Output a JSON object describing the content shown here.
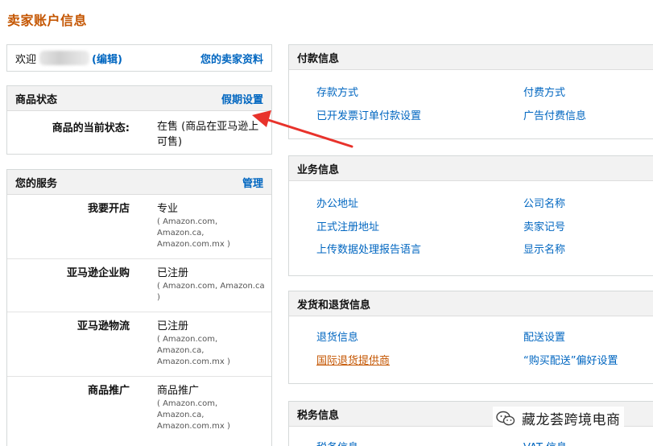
{
  "page": {
    "title": "卖家账户信息"
  },
  "welcome": {
    "label": "欢迎",
    "edit": "(编辑)",
    "profile_link": "您的卖家资料"
  },
  "status": {
    "title": "商品状态",
    "action": "假期设置",
    "row_key": "商品的当前状态:",
    "row_value": "在售 (商品在亚马逊上可售)"
  },
  "services": {
    "title": "您的服务",
    "action": "管理",
    "rows": [
      {
        "key": "我要开店",
        "value": "专业",
        "sub": "( Amazon.com, Amazon.ca, Amazon.com.mx )"
      },
      {
        "key": "亚马逊企业购",
        "value": "已注册",
        "sub": "( Amazon.com, Amazon.ca )"
      },
      {
        "key": "亚马逊物流",
        "value": "已注册",
        "sub": "( Amazon.com, Amazon.ca, Amazon.com.mx )"
      },
      {
        "key": "商品推广",
        "value": "商品推广",
        "sub": "( Amazon.com, Amazon.ca, Amazon.com.mx )"
      }
    ]
  },
  "payment": {
    "title": "付款信息",
    "links": [
      "存款方式",
      "付费方式",
      "已开发票订单付款设置",
      "广告付费信息"
    ]
  },
  "business": {
    "title": "业务信息",
    "links": [
      "办公地址",
      "公司名称",
      "正式注册地址",
      "卖家记号",
      "上传数据处理报告语言",
      "显示名称"
    ]
  },
  "shipping": {
    "title": "发货和退货信息",
    "links": [
      "退货信息",
      "配送设置",
      "国际退货提供商",
      "“购买配送”偏好设置"
    ]
  },
  "tax": {
    "title": "税务信息",
    "links": [
      "税务信息",
      "VAT 信息"
    ]
  },
  "watermark": {
    "text": "藏龙荟跨境电商"
  },
  "colors": {
    "accent_orange": "#c45500",
    "link_blue": "#0066c0",
    "arrow_red": "#e8322b"
  }
}
